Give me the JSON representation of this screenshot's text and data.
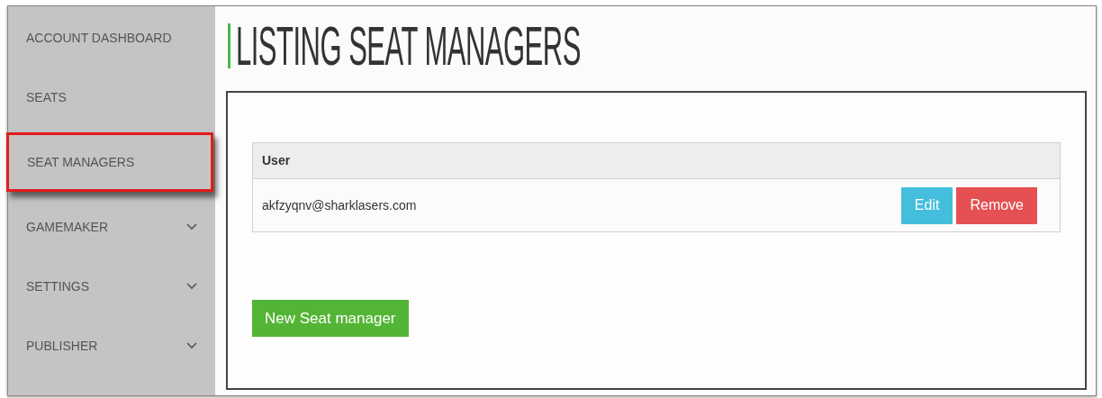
{
  "sidebar": {
    "items": [
      {
        "label": "ACCOUNT DASHBOARD",
        "selected": false,
        "expandable": false
      },
      {
        "label": "SEATS",
        "selected": false,
        "expandable": false
      },
      {
        "label": "SEAT MANAGERS",
        "selected": true,
        "expandable": false
      },
      {
        "label": "GAMEMAKER",
        "selected": false,
        "expandable": true
      },
      {
        "label": "SETTINGS",
        "selected": false,
        "expandable": true
      },
      {
        "label": "PUBLISHER",
        "selected": false,
        "expandable": true
      }
    ]
  },
  "page_title": "LISTING SEAT MANAGERS",
  "table": {
    "columns": [
      "User"
    ],
    "rows": [
      {
        "user": "akfzyqnv@sharklasers.com",
        "actions": [
          {
            "label": "Edit",
            "kind": "edit"
          },
          {
            "label": "Remove",
            "kind": "remove"
          }
        ]
      }
    ]
  },
  "new_button": "New Seat manager"
}
